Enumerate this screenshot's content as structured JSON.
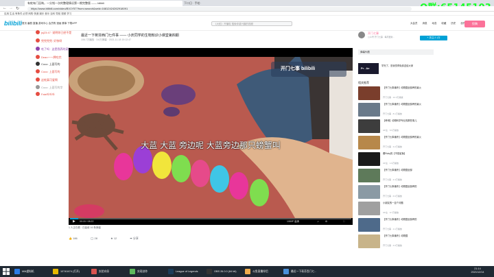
{
  "browser": {
    "tab_title": "有蛇有门没呐，一分钱一次的整理情况第一期完整版 —— bilibili",
    "tab2_title": "下口日 · 手绘·",
    "url": "https://www.bilibili.com/video/BV1Y57?from=search&seid=16812424262918091",
    "bookmarks": "应用  生活  有条件  必须  网购  快递  娱乐  音乐  百科  导航  视频  学习"
  },
  "overlay": {
    "qq_group": "Q群:65145103"
  },
  "site": {
    "logo": "bilibili",
    "nav": "首页  番剧  直播  游戏中心  会员购  漫画  赛事  下载APP",
    "search_placeholder": "《大蛇》开播啦 搜索你感兴趣的视频",
    "header_right": "大会员  消息  动态  收藏  历史  创作中心",
    "upload_label": "投稿"
  },
  "video": {
    "title": "最近一下蒋芬西门七件事 —— 小庆同学的生物知识小课堂第四期",
    "stats": "106.7万播放 · 3.6万弹幕 · 2021-11-18 19:12:47",
    "subtitle": "大蓝  大蓝 旁边呢  大蓝旁边那只螃蟹叫",
    "watermark": "开门七事 bilibili",
    "time": "00:15 / 08:22",
    "quality": "1080P 高清",
    "progress": 0.03,
    "under": "1 人正在看 · 已装填 16 条弹幕",
    "likes": "186",
    "coins": "28",
    "favs": "12",
    "share": "分享"
  },
  "danmaku": [
    {
      "text": "jsj23:47 ·说明你已经不是",
      "color": "#e54d42"
    },
    {
      "text": "兜兜兜兜: 好快呀",
      "color": "#e54d42"
    },
    {
      "text": "吃了吗 · 这是我养的宠物",
      "color": "#8e44ad"
    },
    {
      "text": "Dean一一牌吃完",
      "color": "#e54d42"
    },
    {
      "text": "Coco: 上面写的",
      "color": "#333333"
    },
    {
      "text": "Coco: 上面写的",
      "color": "#e54d42"
    },
    {
      "text": "这蛇真可爱啊",
      "color": "#e54d42"
    },
    {
      "text": "Coco: 上面写的字",
      "color": "#999999"
    },
    {
      "text": "Fate叶叶叶",
      "color": "#e54d42"
    }
  ],
  "uploader": {
    "name": "开门七事",
    "desc": "公众号 开门七事 · 每周更新...",
    "follow_label": "+ 关注 2.1万"
  },
  "sidebar": {
    "danmaku_list": "弹幕列表",
    "ad_text": "Pr . Ae",
    "ad_caption": "学完了，是我觉得免费送给大家",
    "rec_title": "相关推荐",
    "recs": [
      {
        "title": "【开门七事番外】动物园全部养的最火",
        "meta": "开门七事 · 12.3万播放"
      },
      {
        "title": "【开门七事番外】动物园全部养的最火",
        "meta": "开门七事 · 8.1万播放"
      },
      {
        "title": "【考研】动物科学专业的那些事儿",
        "meta": "UP主 · 5.5万播放"
      },
      {
        "title": "【开门七事番外】动物园全部养的最火",
        "meta": "开门七事 · 3.2万播放"
      },
      {
        "title": "看Ruby的【不是鲨鱼】",
        "meta": "UP主 · 1.9万播放"
      },
      {
        "title": "【开门七事番外】动物园全部",
        "meta": "开门七事 · 2.4万播放"
      },
      {
        "title": "【开门七事番外】动物园全部养的",
        "meta": "开门七事 · 6.6万播放"
      },
      {
        "title": "小朋友的一百个问题",
        "meta": "UP主 · 9.7万播放"
      },
      {
        "title": "【开门七事番外】动物园全部养的",
        "meta": "开门七事 · 1.1万播放"
      },
      {
        "title": "【开门七事番外】动物园",
        "meta": "开门七事 · 4.0万播放"
      }
    ]
  },
  "taskbar": {
    "items": [
      {
        "label": "MM虚拟机",
        "color": "#2c7be5"
      },
      {
        "label": "10740474 (打开)",
        "color": "#e6b800"
      },
      {
        "label": "实验向导",
        "color": "#d9534f"
      },
      {
        "label": "实现创作",
        "color": "#5cb85c"
      },
      {
        "label": "League of Legends",
        "color": "#1c3d5a"
      },
      {
        "label": "OBS 26.0.0 (64 bit)",
        "color": "#333333"
      },
      {
        "label": "斗鱼直播伴侣",
        "color": "#f0ad4e"
      },
      {
        "label": "最近一下蒋芬西门七...",
        "color": "#4a90d9"
      }
    ],
    "time": "21:14",
    "date": "2021/12/14"
  }
}
